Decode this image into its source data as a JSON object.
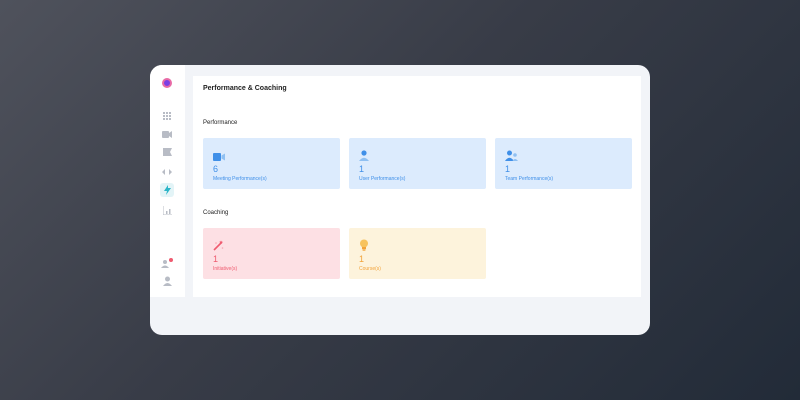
{
  "page_title": "Performance & Coaching",
  "sections": {
    "performance": {
      "label": "Performance",
      "cards": [
        {
          "count": "6",
          "label": "Meeting Performance(s)",
          "icon": "video-icon"
        },
        {
          "count": "1",
          "label": "User Performance(s)",
          "icon": "user-icon"
        },
        {
          "count": "1",
          "label": "Team Performance(s)",
          "icon": "team-icon"
        }
      ]
    },
    "coaching": {
      "label": "Coaching",
      "cards": [
        {
          "count": "1",
          "label": "Initiative(s)",
          "icon": "magic-wand-icon"
        },
        {
          "count": "1",
          "label": "Course(s)",
          "icon": "lightbulb-icon"
        }
      ]
    }
  },
  "colors": {
    "accent_blue": "#3f8fe8",
    "accent_pink": "#ef5b6f",
    "accent_yellow": "#f2a33a",
    "active_nav": "#2bb5c8"
  },
  "sidebar": {
    "icons": [
      "logo-icon",
      "grid-icon",
      "video-icon",
      "flag-icon",
      "compare-icon",
      "lightning-icon",
      "chart-icon",
      "users-alert-icon",
      "user-icon"
    ],
    "active": "lightning-icon"
  }
}
